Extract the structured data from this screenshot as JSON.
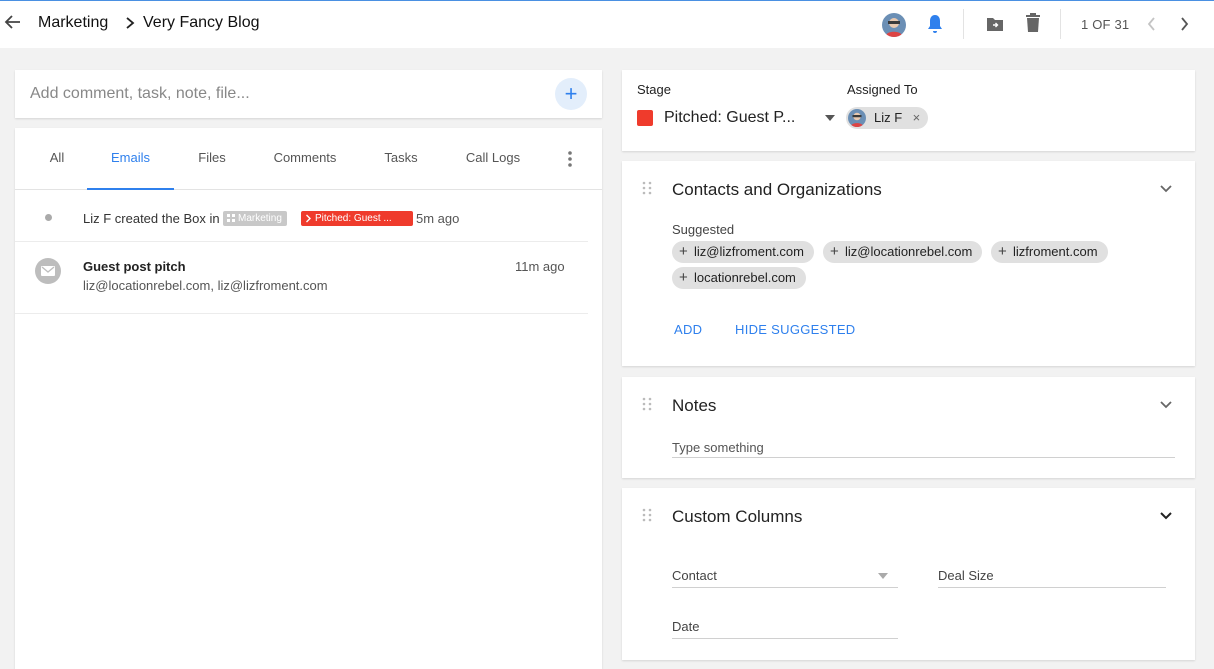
{
  "header": {
    "breadcrumb_parent": "Marketing",
    "breadcrumb_current": "Very Fancy Blog",
    "pager_text": "1 OF 31"
  },
  "composer": {
    "placeholder": "Add comment, task, note, file...",
    "add_label": "+"
  },
  "tabs": [
    {
      "label": "All"
    },
    {
      "label": "Emails"
    },
    {
      "label": "Files"
    },
    {
      "label": "Comments"
    },
    {
      "label": "Tasks"
    },
    {
      "label": "Call Logs"
    }
  ],
  "active_tab": "Emails",
  "feed": {
    "activity": {
      "text": "Liz F created the Box in",
      "pipeline_chip": "Marketing",
      "stage_chip": "Pitched: Guest ...",
      "time": "5m ago"
    },
    "email": {
      "subject": "Guest post pitch",
      "recipients": "liz@locationrebel.com, liz@lizfroment.com",
      "time": "11m ago"
    }
  },
  "stage_card": {
    "stage_label": "Stage",
    "stage_value": "Pitched: Guest P...",
    "stage_color": "#ef3b2c",
    "assigned_label": "Assigned To",
    "assignee": "Liz F",
    "remove_glyph": "×"
  },
  "contacts": {
    "title": "Contacts and Organizations",
    "suggested_label": "Suggested",
    "suggestions": [
      "liz@lizfroment.com",
      "liz@locationrebel.com",
      "lizfroment.com",
      "locationrebel.com"
    ],
    "add_label": "ADD",
    "hide_label": "HIDE SUGGESTED"
  },
  "notes": {
    "title": "Notes",
    "placeholder": "Type something"
  },
  "custom_columns": {
    "title": "Custom Columns",
    "fields": [
      {
        "label": "Contact"
      },
      {
        "label": "Deal Size"
      },
      {
        "label": "Date"
      }
    ]
  },
  "colors": {
    "accent": "#2f80ed",
    "stage_red": "#ef3b2c",
    "chip_gray": "#e0e0e0",
    "background": "#f2f2f2"
  },
  "icons": [
    "back-arrow-icon",
    "chevron-right-icon",
    "bell-icon",
    "folder-move-icon",
    "trash-icon",
    "chevron-left-icon",
    "more-vert-icon",
    "mail-icon",
    "drag-handle-icon",
    "chevron-down-icon",
    "caret-down-icon",
    "plus-icon",
    "close-icon"
  ]
}
